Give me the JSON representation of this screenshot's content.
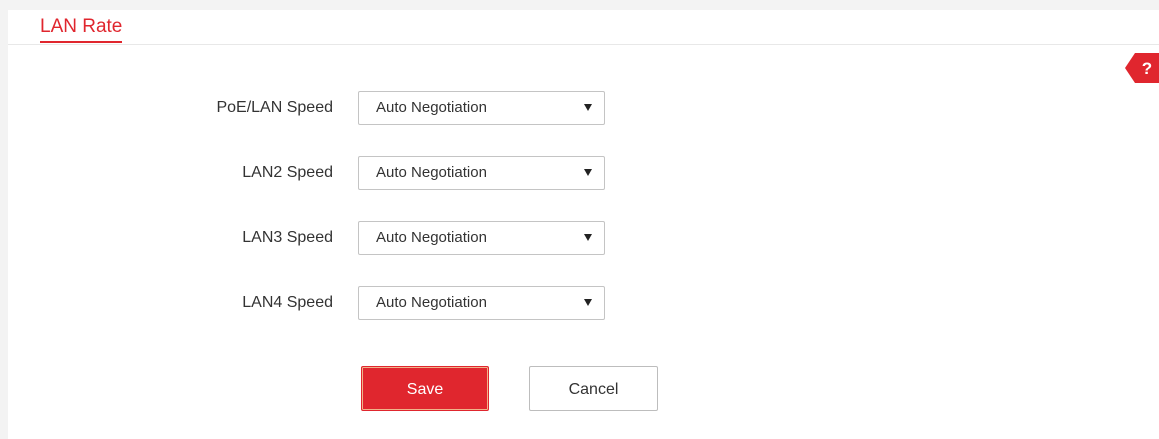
{
  "section": {
    "title": "LAN Rate"
  },
  "help": {
    "label": "?",
    "icon": "help-icon"
  },
  "form": {
    "rows": [
      {
        "label": "PoE/LAN Speed",
        "value": "Auto Negotiation"
      },
      {
        "label": "LAN2 Speed",
        "value": "Auto Negotiation"
      },
      {
        "label": "LAN3 Speed",
        "value": "Auto Negotiation"
      },
      {
        "label": "LAN4 Speed",
        "value": "Auto Negotiation"
      }
    ]
  },
  "buttons": {
    "save": "Save",
    "cancel": "Cancel"
  },
  "colors": {
    "accent": "#e0262e",
    "page_background": "#f3f3f3",
    "text": "#333333"
  }
}
